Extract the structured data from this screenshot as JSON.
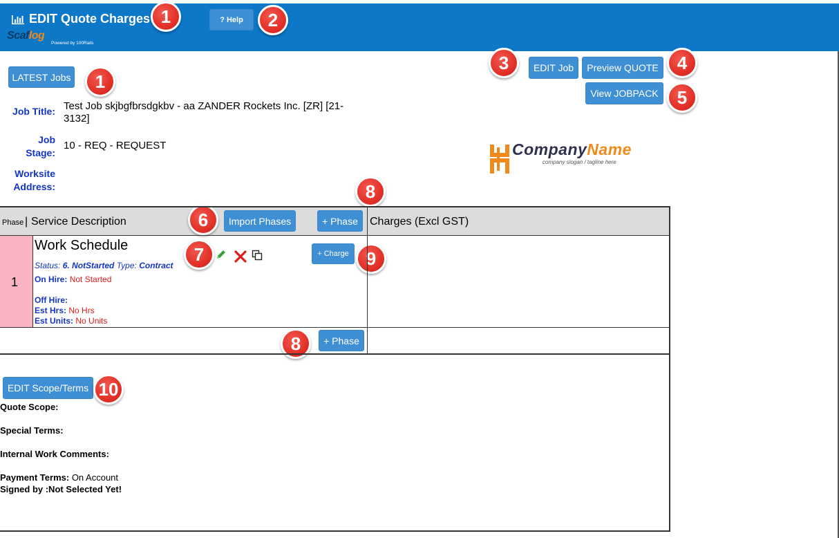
{
  "header": {
    "title": "EDIT Quote Charges",
    "help_label": "? Help",
    "logo_text_a": "Scaf",
    "logo_text_b": "log",
    "logo_powered": "Powered by 100Rails"
  },
  "nav": {
    "latest_jobs": "LATEST Jobs",
    "edit_job": "EDIT Job",
    "preview_quote": "Preview QUOTE",
    "view_jobpack": "View JOBPACK"
  },
  "job": {
    "title_label": "Job Title:",
    "title_value_line1": "Test Job skjbgfbrsdgkbv - aa ZANDER Rockets Inc. [ZR] [21-",
    "title_value_line2": "3132]",
    "stage_label_1": "Job",
    "stage_label_2": "Stage:",
    "stage_value": "10 - REQ - REQUEST",
    "worksite_label_1": "Worksite",
    "worksite_label_2": "Address:"
  },
  "company": {
    "name_a": "Company",
    "name_b": "Name",
    "slogan": "company slogan / tagline here"
  },
  "table": {
    "phase_col": "Phase",
    "sep": "|",
    "service_col": "Service Description",
    "import_phases": "Import Phases",
    "add_phase": "+ Phase",
    "charges_col": "Charges (Excl GST)",
    "rows": [
      {
        "num": "1",
        "name": "Work Schedule",
        "status_label": "Status:",
        "status_value": "6. NotStarted",
        "type_label": "Type:",
        "type_value": "Contract",
        "on_hire_label": "On Hire:",
        "on_hire_value": "Not Started",
        "off_hire_label": "Off Hire:",
        "est_hrs_label": "Est Hrs:",
        "est_hrs_value": "No Hrs",
        "est_units_label": "Est Units:",
        "est_units_value": "No Units",
        "add_charge": "+ Charge"
      }
    ],
    "add_phase_bottom": "+ Phase"
  },
  "scope": {
    "edit_button": "EDIT Scope/Terms",
    "quote_scope": "Quote Scope:",
    "special_terms": "Special Terms:",
    "internal_comments": "Internal Work Comments:",
    "payment_terms_label": "Payment Terms:",
    "payment_terms_value": "On Account",
    "signed_by": "Signed by :Not Selected Yet!"
  },
  "badges": [
    "1",
    "2",
    "1",
    "3",
    "4",
    "5",
    "6",
    "8",
    "7",
    "9",
    "8",
    "10"
  ],
  "colors": {
    "header_blue": "#0d77c8",
    "button_blue": "#3f8fd4",
    "label_blue": "#1434c8",
    "badge_red": "#e23128",
    "phase_pink": "#f9b3c1",
    "status_red": "#e21b1b"
  }
}
